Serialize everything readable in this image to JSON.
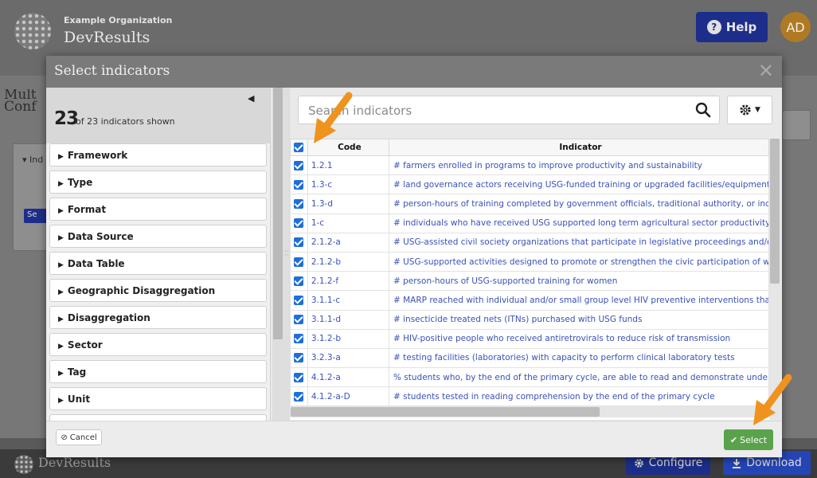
{
  "app": {
    "org_name": "Example Organization",
    "app_name": "DevResults",
    "help_label": "Help",
    "avatar_initials": "AD",
    "page_title": "Mult Conf",
    "bg_panel_label": "Ind",
    "bg_button_label": "Se",
    "footer_name": "DevResults",
    "configure_label": "Configure",
    "download_label": "Download"
  },
  "modal": {
    "title": "Select indicators",
    "count": "23",
    "count_text": "of 23 indicators shown",
    "filters": [
      {
        "label": "Framework"
      },
      {
        "label": "Type"
      },
      {
        "label": "Format"
      },
      {
        "label": "Data Source"
      },
      {
        "label": "Data Table"
      },
      {
        "label": "Geographic Disaggregation"
      },
      {
        "label": "Disaggregation"
      },
      {
        "label": "Sector"
      },
      {
        "label": "Tag"
      },
      {
        "label": "Unit"
      },
      {
        "label": ""
      }
    ],
    "search_placeholder": "Search indicators",
    "cancel_label": "Cancel",
    "select_label": "Select",
    "table": {
      "columns": [
        "Code",
        "Indicator"
      ],
      "rows": [
        {
          "code": "1.2.1",
          "indicator": "# farmers enrolled in programs to improve productivity and sustainability"
        },
        {
          "code": "1.3-c",
          "indicator": "# land governance actors receiving USG-funded training or upgraded facilities/equipment"
        },
        {
          "code": "1.3-d",
          "indicator": "# person-hours of training completed by government officials, traditional authority, or indiv"
        },
        {
          "code": "1-c",
          "indicator": "# individuals who have received USG supported long term agricultural sector productivity o"
        },
        {
          "code": "2.1.2-a",
          "indicator": "# USG-assisted civil society organizations that participate in legislative proceedings and/or e"
        },
        {
          "code": "2.1.2-b",
          "indicator": "# USG-supported activities designed to promote or strengthen the civic participation of wor"
        },
        {
          "code": "2.1.2-f",
          "indicator": "# person-hours of USG-supported training for women"
        },
        {
          "code": "3.1.1-c",
          "indicator": "# MARP reached with individual and/or small group level HIV preventive interventions that a"
        },
        {
          "code": "3.1.1-d",
          "indicator": "# insecticide treated nets (ITNs) purchased with USG funds"
        },
        {
          "code": "3.1.2-b",
          "indicator": "# HIV-positive people who received antiretrovirals to reduce risk of transmission"
        },
        {
          "code": "3.2.3-a",
          "indicator": "# testing facilities (laboratories) with capacity to perform clinical laboratory tests"
        },
        {
          "code": "4.1.2-a",
          "indicator": "% students who, by the end of the primary cycle, are able to read and demonstrate underst"
        },
        {
          "code": "4.1.2-a-D",
          "indicator": "# students tested in reading comprehension by the end of the primary cycle"
        }
      ]
    }
  },
  "colors": {
    "accent": "#1e6fd9",
    "link": "#3a51b8",
    "select_button": "#5aa34c",
    "arrow": "#f0921e"
  }
}
